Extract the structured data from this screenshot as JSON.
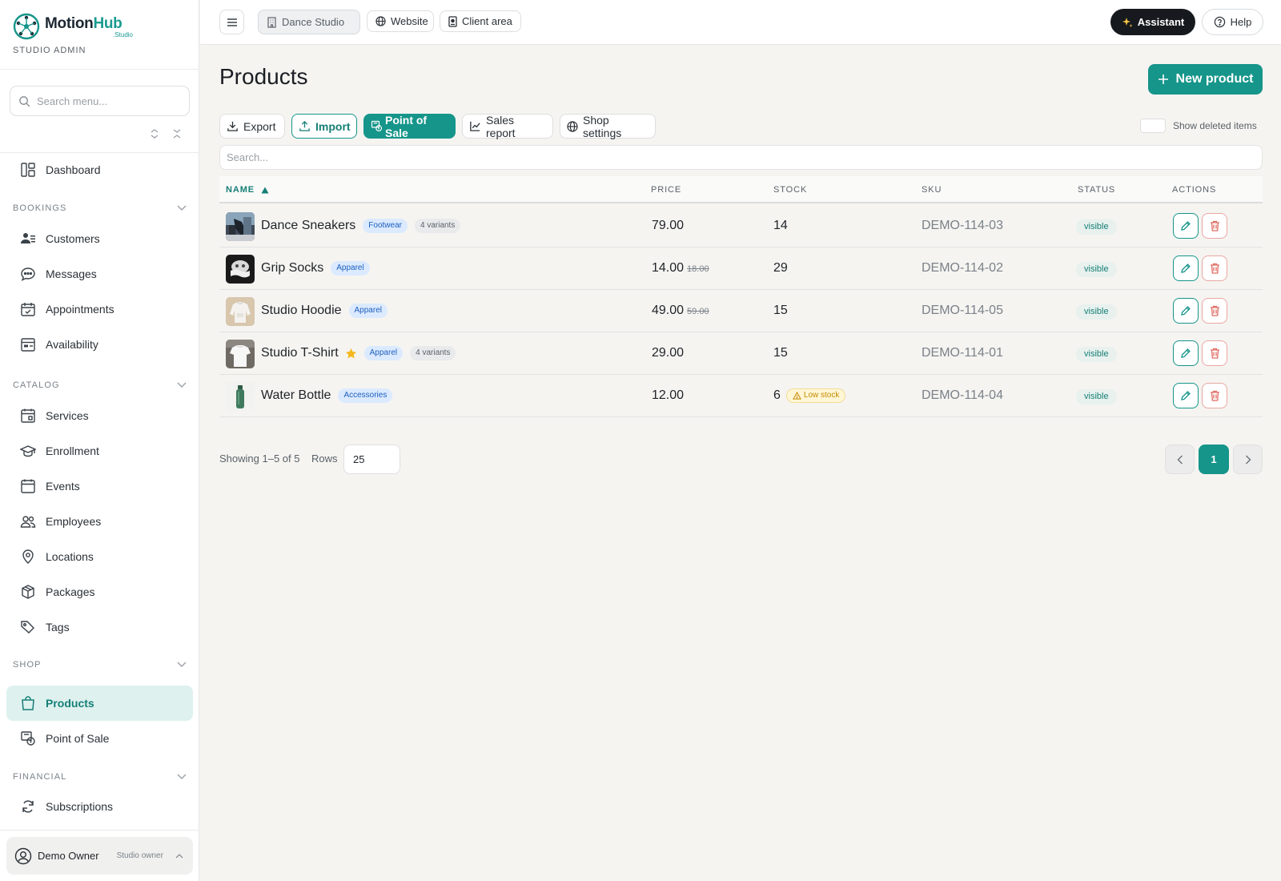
{
  "brand": {
    "name_a": "Motion",
    "name_b": "Hub",
    "sub": ".Studio",
    "role": "STUDIO ADMIN",
    "accent_color": "#16958a"
  },
  "menu_search": {
    "placeholder": "Search menu..."
  },
  "nav": {
    "dashboard": "Dashboard",
    "sections": {
      "bookings": "BOOKINGS",
      "catalog": "CATALOG",
      "shop": "SHOP",
      "financial": "FINANCIAL"
    },
    "bookings": [
      "Customers",
      "Messages",
      "Appointments",
      "Availability"
    ],
    "catalog": [
      "Services",
      "Enrollment",
      "Events",
      "Employees",
      "Locations",
      "Packages",
      "Tags"
    ],
    "shop": [
      "Products",
      "Point of Sale"
    ],
    "financial": [
      "Subscriptions"
    ],
    "active": "Products"
  },
  "user": {
    "name": "Demo Owner",
    "role": "Studio owner"
  },
  "topbar": {
    "studio": "Dance Studio",
    "website": "Website",
    "client_area": "Client area",
    "assistant": "Assistant",
    "help": "Help"
  },
  "page": {
    "title": "Products",
    "new_product": "New product",
    "actions": {
      "export": "Export",
      "import": "Import",
      "pos": "Point of Sale",
      "sales_report": "Sales report",
      "shop_settings": "Shop settings"
    },
    "show_deleted": "Show deleted items",
    "search_placeholder": "Search..."
  },
  "table": {
    "columns": {
      "name": "NAME",
      "price": "PRICE",
      "stock": "STOCK",
      "sku": "SKU",
      "status": "STATUS",
      "actions": "ACTIONS"
    },
    "sort": {
      "column": "name",
      "direction": "asc"
    },
    "rows": [
      {
        "name": "Dance Sneakers",
        "category": "Footwear",
        "variants": "4 variants",
        "featured": false,
        "price": "79.00",
        "old_price": "",
        "stock": "14",
        "low_stock": "",
        "sku": "DEMO-114-03",
        "status": "visible",
        "thumb": "sneakers"
      },
      {
        "name": "Grip Socks",
        "category": "Apparel",
        "variants": "",
        "featured": false,
        "price": "14.00",
        "old_price": "18.00",
        "stock": "29",
        "low_stock": "",
        "sku": "DEMO-114-02",
        "status": "visible",
        "thumb": "socks"
      },
      {
        "name": "Studio Hoodie",
        "category": "Apparel",
        "variants": "",
        "featured": false,
        "price": "49.00",
        "old_price": "59.00",
        "stock": "15",
        "low_stock": "",
        "sku": "DEMO-114-05",
        "status": "visible",
        "thumb": "hoodie"
      },
      {
        "name": "Studio T-Shirt",
        "category": "Apparel",
        "variants": "4 variants",
        "featured": true,
        "price": "29.00",
        "old_price": "",
        "stock": "15",
        "low_stock": "",
        "sku": "DEMO-114-01",
        "status": "visible",
        "thumb": "tshirt"
      },
      {
        "name": "Water Bottle",
        "category": "Accessories",
        "variants": "",
        "featured": false,
        "price": "12.00",
        "old_price": "",
        "stock": "6",
        "low_stock": "Low stock",
        "sku": "DEMO-114-04",
        "status": "visible",
        "thumb": "bottle"
      }
    ]
  },
  "pagination": {
    "showing": "Showing 1–5 of 5",
    "rows_label": "Rows",
    "rows_value": "25",
    "current_page": "1"
  }
}
